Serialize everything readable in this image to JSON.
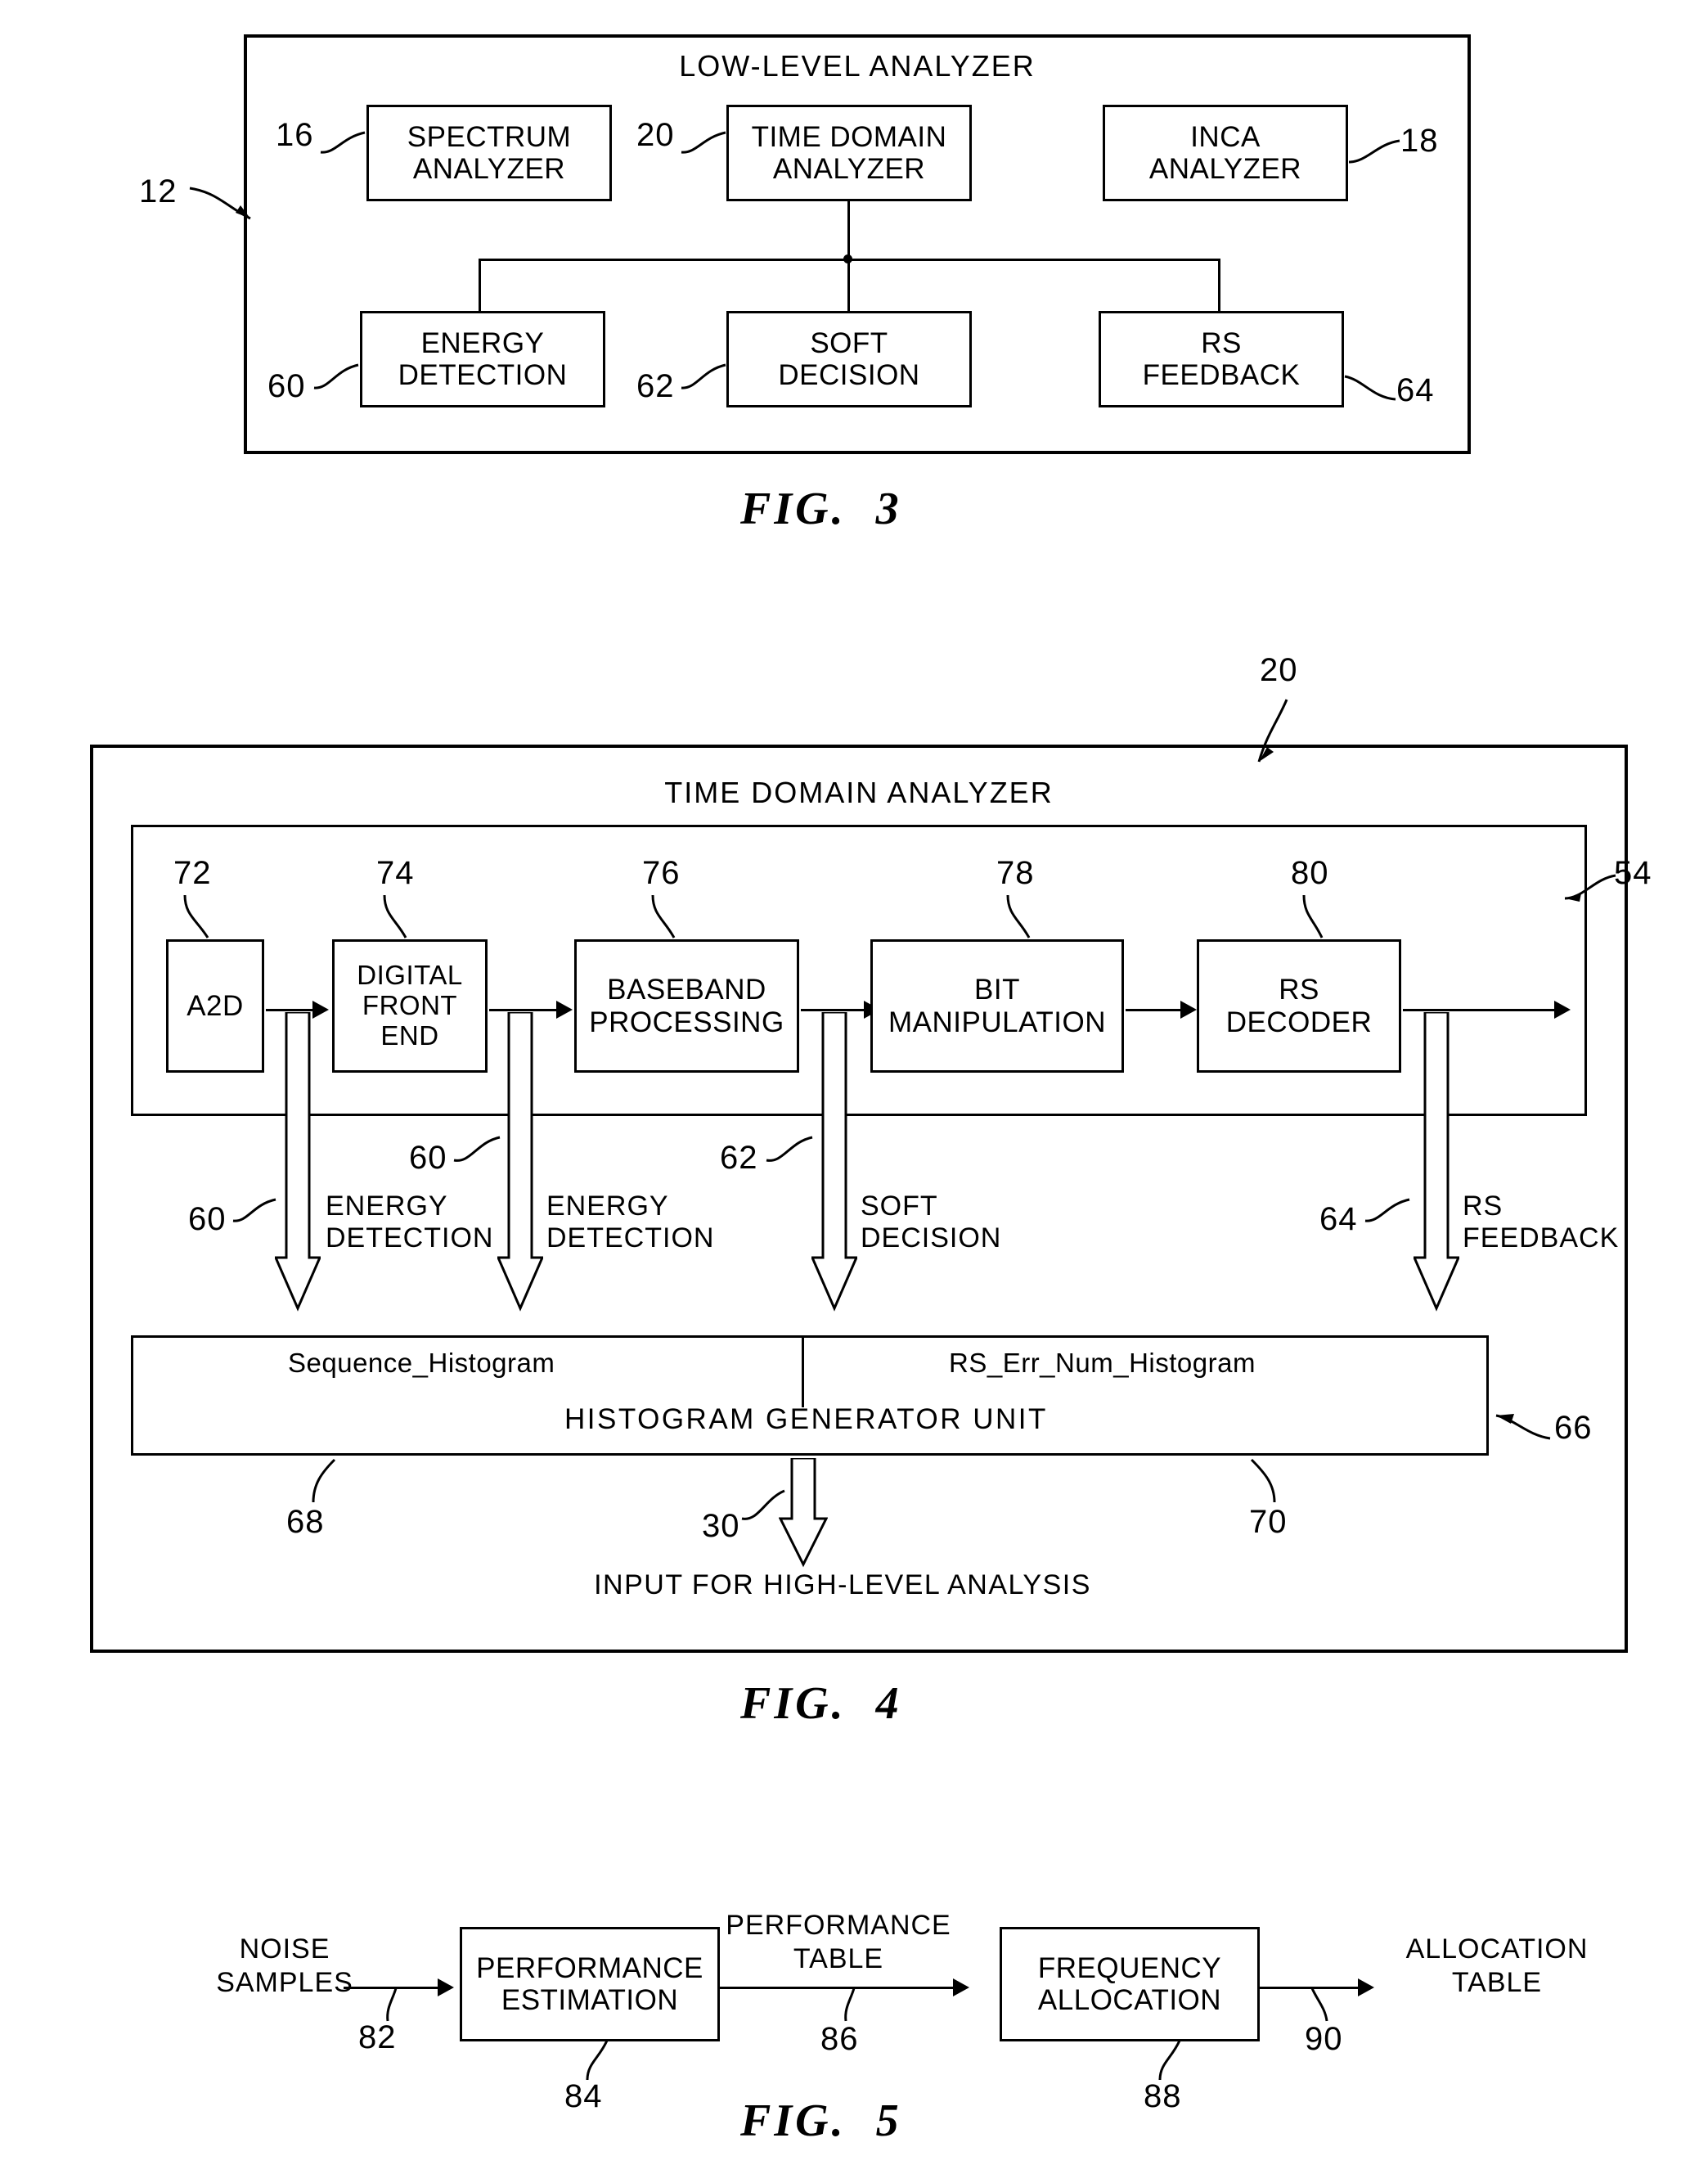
{
  "figure3": {
    "title": "LOW-LEVEL ANALYZER",
    "fig_label": "FIG.  3",
    "enclosure_ref": "12",
    "top_blocks": [
      {
        "ref": "16",
        "label": "SPECTRUM\nANALYZER"
      },
      {
        "ref": "20",
        "label": "TIME DOMAIN\nANALYZER"
      },
      {
        "ref": "18",
        "label": "INCA\nANALYZER"
      }
    ],
    "bottom_blocks": [
      {
        "ref": "60",
        "label": "ENERGY\nDETECTION"
      },
      {
        "ref": "62",
        "label": "SOFT\nDECISION"
      },
      {
        "ref": "64",
        "label": "RS\nFEEDBACK"
      }
    ]
  },
  "figure4": {
    "title": "TIME DOMAIN ANALYZER",
    "fig_label": "FIG.  4",
    "enclosure_ref": "20",
    "chain_ref": "54",
    "chain_blocks": [
      {
        "ref": "72",
        "label": "A2D"
      },
      {
        "ref": "74",
        "label": "DIGITAL\nFRONT\nEND"
      },
      {
        "ref": "76",
        "label": "BASEBAND\nPROCESSING"
      },
      {
        "ref": "78",
        "label": "BIT\nMANIPULATION"
      },
      {
        "ref": "80",
        "label": "RS\nDECODER"
      }
    ],
    "taps": [
      {
        "ref": "60",
        "label": "ENERGY\nDETECTION"
      },
      {
        "ref": "60",
        "label": "ENERGY\nDETECTION"
      },
      {
        "ref": "62",
        "label": "SOFT\nDECISION"
      },
      {
        "ref": "64",
        "label": "RS\nFEEDBACK"
      }
    ],
    "histogram": {
      "unit_title": "HISTOGRAM GENERATOR UNIT",
      "unit_ref": "66",
      "left_name": "Sequence_Histogram",
      "left_ref": "68",
      "right_name": "RS_Err_Num_Histogram",
      "right_ref": "70"
    },
    "output": {
      "ref": "30",
      "label": "INPUT FOR HIGH-LEVEL ANALYSIS"
    }
  },
  "figure5": {
    "fig_label": "FIG.  5",
    "input_label": "NOISE\nSAMPLES",
    "input_ref": "82",
    "blocks": [
      {
        "ref": "84",
        "label": "PERFORMANCE\nESTIMATION"
      },
      {
        "ref": "88",
        "label": "FREQUENCY\nALLOCATION"
      }
    ],
    "mid_label": "PERFORMANCE\nTABLE",
    "mid_ref": "86",
    "output_label": "ALLOCATION\nTABLE",
    "output_ref": "90"
  }
}
